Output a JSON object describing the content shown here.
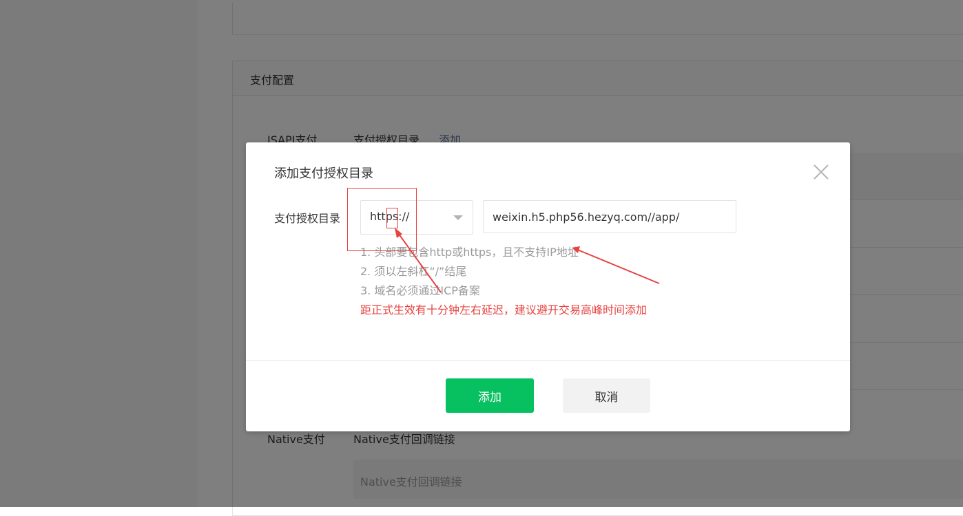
{
  "background": {
    "card_title": "支付配置",
    "jsapi_label": "JSAPI支付",
    "jsapi_dir_label": "支付授权目录",
    "jsapi_add_link": "添加",
    "native_label": "Native支付",
    "native_callback_label": "Native支付回调链接",
    "native_callback_placeholder": "Native支付回调链接"
  },
  "dialog": {
    "title": "添加支付授权目录",
    "field_label": "支付授权目录",
    "protocol_select_value": "https://",
    "url_input_value": "weixin.h5.php56.hezyq.com//app/",
    "tips": [
      "1. 头部要包含http或https，且不支持IP地址",
      "2. 须以左斜杠“/”结尾",
      "3. 域名必须通过ICP备案"
    ],
    "warning": "距正式生效有十分钟左右延迟，建议避开交易高峰时间添加",
    "confirm_label": "添加",
    "cancel_label": "取消"
  },
  "colors": {
    "primary": "#07c160",
    "warning": "#e64340",
    "link": "#576b95",
    "annotation": "#e64340"
  }
}
